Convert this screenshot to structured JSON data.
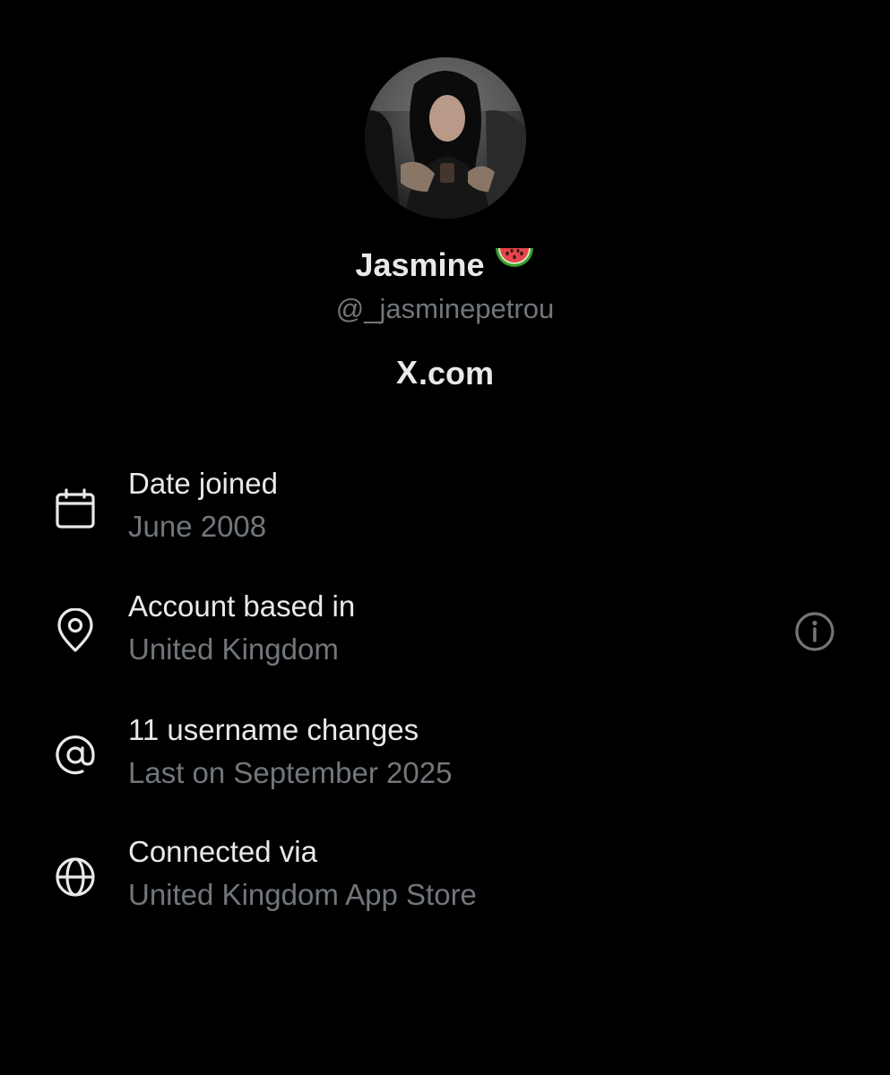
{
  "profile": {
    "display_name": "Jasmine",
    "name_emoji": "watermelon-emoji",
    "handle": "@_jasminepetrou",
    "site_prefix": "X",
    "site_suffix": ".com"
  },
  "about": {
    "rows": [
      {
        "icon": "calendar-icon",
        "title": "Date joined",
        "subtitle": "June 2008"
      },
      {
        "icon": "location-pin-icon",
        "title": "Account based in",
        "subtitle": "United Kingdom"
      },
      {
        "icon": "at-sign-icon",
        "title": "11 username changes",
        "subtitle": "Last on September 2025"
      },
      {
        "icon": "globe-icon",
        "title": "Connected via",
        "subtitle": "United Kingdom App Store"
      }
    ],
    "info_icon": "info-icon"
  },
  "colors": {
    "background": "#000000",
    "primary_text": "#e7e9ea",
    "secondary_text": "#71767b"
  }
}
